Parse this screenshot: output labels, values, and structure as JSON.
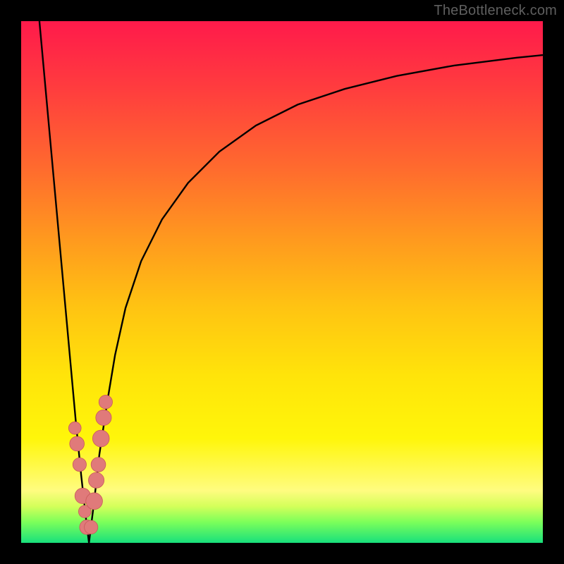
{
  "watermark": "TheBottleneck.com",
  "colors": {
    "curve": "#000000",
    "markers": "#e07a7a",
    "marker_stroke": "#c85a5a"
  },
  "chart_data": {
    "type": "line",
    "title": "",
    "xlabel": "",
    "ylabel": "",
    "xlim": [
      0,
      100
    ],
    "ylim": [
      0,
      100
    ],
    "grid": false,
    "legend": false,
    "background": "rainbow-vertical-gradient",
    "series": [
      {
        "name": "left-branch",
        "x": [
          3.5,
          4.5,
          5.5,
          6.5,
          7.5,
          8.5,
          9.5,
          10.5,
          11.5,
          12.5,
          13.0
        ],
        "y": [
          100,
          89,
          78,
          67,
          56,
          45,
          34,
          23,
          13,
          4,
          0
        ]
      },
      {
        "name": "right-branch",
        "x": [
          13.0,
          14.0,
          15.0,
          16.5,
          18.0,
          20.0,
          23.0,
          27.0,
          32.0,
          38.0,
          45.0,
          53.0,
          62.0,
          72.0,
          83.0,
          95.0,
          100.0
        ],
        "y": [
          0,
          8,
          17,
          27,
          36,
          45,
          54,
          62,
          69,
          75,
          80,
          84,
          87,
          89.5,
          91.5,
          93,
          93.5
        ]
      }
    ],
    "markers": [
      {
        "x": 10.3,
        "y": 22,
        "r": 1.2
      },
      {
        "x": 10.7,
        "y": 19,
        "r": 1.4
      },
      {
        "x": 11.2,
        "y": 15,
        "r": 1.3
      },
      {
        "x": 11.8,
        "y": 9,
        "r": 1.5
      },
      {
        "x": 12.2,
        "y": 6,
        "r": 1.2
      },
      {
        "x": 12.6,
        "y": 3,
        "r": 1.4
      },
      {
        "x": 13.4,
        "y": 3,
        "r": 1.3
      },
      {
        "x": 14.0,
        "y": 8,
        "r": 1.6
      },
      {
        "x": 14.4,
        "y": 12,
        "r": 1.5
      },
      {
        "x": 14.8,
        "y": 15,
        "r": 1.4
      },
      {
        "x": 15.3,
        "y": 20,
        "r": 1.6
      },
      {
        "x": 15.8,
        "y": 24,
        "r": 1.5
      },
      {
        "x": 16.2,
        "y": 27,
        "r": 1.3
      }
    ]
  }
}
